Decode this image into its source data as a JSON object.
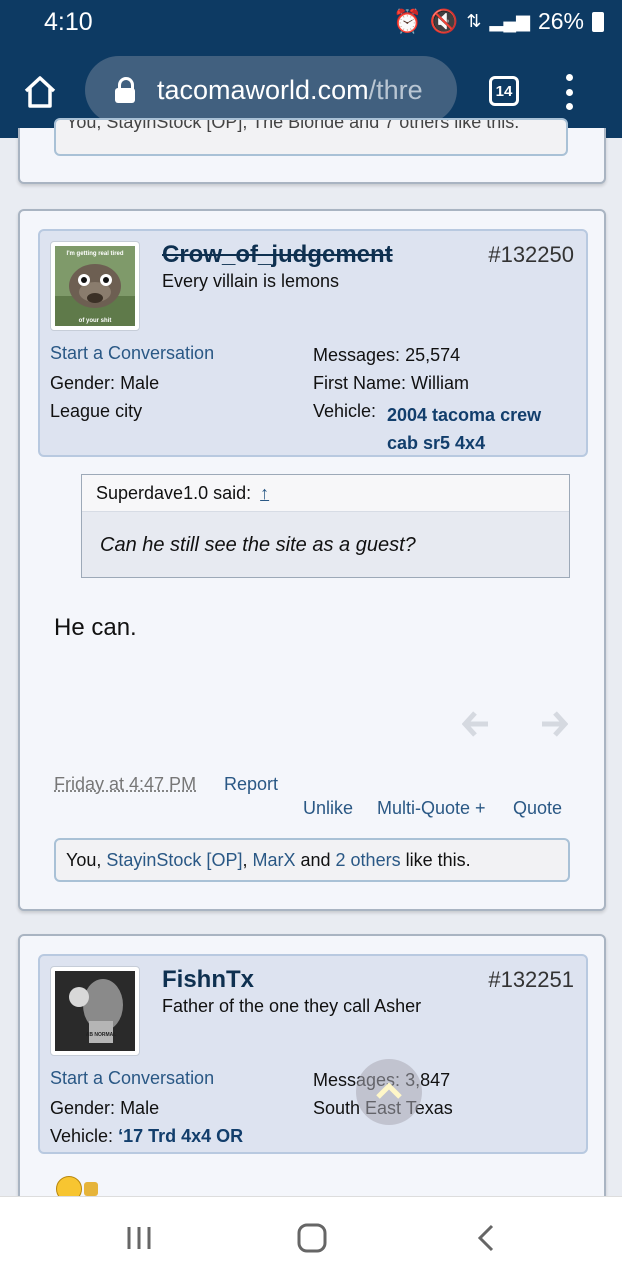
{
  "status_bar": {
    "time": "4:10",
    "battery": "26%"
  },
  "browser": {
    "url_domain": "tacomaworld.com",
    "url_rest": "/thre",
    "tab_count": "14"
  },
  "prev_likes_text": "You, StayinStock [OP], The Blonde and 7 others like this.",
  "post1": {
    "username": "Crow_of_judgement",
    "user_title": "Every villain is lemons",
    "post_number": "#132250",
    "avatar_caption_top": "I'm getting real tired",
    "avatar_caption_bottom": "of your shit",
    "start_conversation": "Start a Conversation",
    "gender_label": "Gender:",
    "gender": "Male",
    "location": "League city",
    "messages_label": "Messages:",
    "messages": "25,574",
    "first_name_label": "First Name:",
    "first_name": "William",
    "vehicle_label": "Vehicle:",
    "vehicle_line1": "2004 tacoma crew",
    "vehicle_line2": "cab sr5 4x4",
    "quote_author": "Superdave1.0 said:",
    "quote_arrow": "↑",
    "quote_text": "Can he still see the site as a guest?",
    "body": "He can.",
    "timestamp": "Friday at 4:47 PM",
    "report": "Report",
    "unlike": "Unlike",
    "multiquote": "Multi-Quote +",
    "quote": "Quote",
    "likes": {
      "prefix": "You, ",
      "user1": "StayinStock [OP]",
      "sep": ", ",
      "user2": "MarX",
      "and": " and ",
      "others": "2 others",
      "suffix": " like this."
    }
  },
  "post2": {
    "username": "FishnTx",
    "user_title": "Father of the one they call Asher",
    "post_number": "#132251",
    "avatar_badge": "AB NORMAL",
    "start_conversation": "Start a Conversation",
    "gender_label": "Gender:",
    "gender": "Male",
    "vehicle_label": "Vehicle:",
    "vehicle": "‘17 Trd 4x4 OR",
    "messages_label": "Messages:",
    "messages": "3,847",
    "location": "South East Texas"
  },
  "colors": {
    "header": "#0d3a63",
    "link": "#2a5885",
    "userbox": "#dde3f0"
  }
}
